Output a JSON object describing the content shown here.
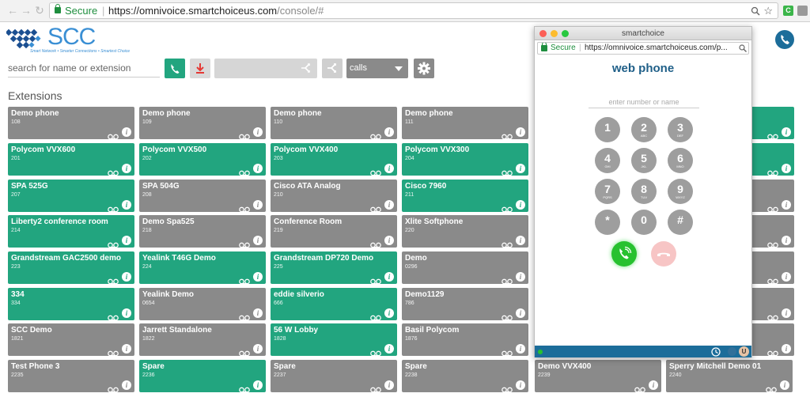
{
  "browser": {
    "secure_label": "Secure",
    "url_host": "https://omnivoice.smartchoiceus.com",
    "url_path": "/console/#",
    "ext_label": "C"
  },
  "brand": {
    "logo_text": "SCC",
    "tagline": "Smart Network • Smarter Connections • Smartest Choice",
    "accent": "#22a57f",
    "gray": "#8a8a8a",
    "blue": "#1c6d9a"
  },
  "toolbar": {
    "search_placeholder": "search for name or extension",
    "calls_label": "calls"
  },
  "section_title": "Extensions",
  "extensions": [
    [
      {
        "name": "Demo phone",
        "ext": "108",
        "status": "gray"
      },
      {
        "name": "Demo phone",
        "ext": "109",
        "status": "gray"
      },
      {
        "name": "Demo phone",
        "ext": "110",
        "status": "gray"
      },
      {
        "name": "Demo phone",
        "ext": "111",
        "status": "gray"
      }
    ],
    [
      {
        "name": "Polycom VVX600",
        "ext": "201",
        "status": "green"
      },
      {
        "name": "Polycom VVX500",
        "ext": "202",
        "status": "green"
      },
      {
        "name": "Polycom VVX400",
        "ext": "203",
        "status": "green"
      },
      {
        "name": "Polycom VVX300",
        "ext": "204",
        "status": "green"
      }
    ],
    [
      {
        "name": "SPA 525G",
        "ext": "207",
        "status": "green"
      },
      {
        "name": "SPA 504G",
        "ext": "208",
        "status": "gray"
      },
      {
        "name": "Cisco ATA Analog",
        "ext": "210",
        "status": "gray"
      },
      {
        "name": "Cisco 7960",
        "ext": "211",
        "status": "green"
      }
    ],
    [
      {
        "name": "Liberty2 conference room",
        "ext": "214",
        "status": "green"
      },
      {
        "name": "Demo Spa525",
        "ext": "218",
        "status": "gray"
      },
      {
        "name": "Conference Room",
        "ext": "219",
        "status": "gray"
      },
      {
        "name": "Xlite Softphone",
        "ext": "220",
        "status": "gray"
      }
    ],
    [
      {
        "name": "Grandstream GAC2500 demo",
        "ext": "223",
        "status": "green"
      },
      {
        "name": "Yealink T46G Demo",
        "ext": "224",
        "status": "green"
      },
      {
        "name": "Grandstream DP720 Demo",
        "ext": "225",
        "status": "green"
      },
      {
        "name": "Demo",
        "ext": "0296",
        "status": "gray"
      }
    ],
    [
      {
        "name": "334",
        "ext": "334",
        "status": "green"
      },
      {
        "name": "Yealink Demo",
        "ext": "0654",
        "status": "gray"
      },
      {
        "name": "eddie silverio",
        "ext": "666",
        "status": "green"
      },
      {
        "name": "Demo1129",
        "ext": "786",
        "status": "gray"
      }
    ],
    [
      {
        "name": "SCC Demo",
        "ext": "1821",
        "status": "gray"
      },
      {
        "name": "Jarrett Standalone",
        "ext": "1822",
        "status": "gray"
      },
      {
        "name": "56 W Lobby",
        "ext": "1828",
        "status": "green"
      },
      {
        "name": "Basil Polycom",
        "ext": "1876",
        "status": "gray"
      }
    ],
    [
      {
        "name": "Test Phone 3",
        "ext": "2235",
        "status": "gray"
      },
      {
        "name": "Spare",
        "ext": "2236",
        "status": "green"
      },
      {
        "name": "Spare",
        "ext": "2237",
        "status": "gray"
      },
      {
        "name": "Spare",
        "ext": "2238",
        "status": "gray"
      },
      {
        "name": "Demo VVX400",
        "ext": "2239",
        "status": "gray"
      },
      {
        "name": "Sperry Mitchell Demo 01",
        "ext": "2240",
        "status": "gray"
      }
    ]
  ],
  "right_column_status": [
    "green",
    "green",
    "gray",
    "gray",
    "gray",
    "gray",
    "gray"
  ],
  "popup": {
    "window_title": "smartchoice",
    "secure_label": "Secure",
    "url": "https://omnivoice.smartchoiceus.com/p...",
    "title": "web phone",
    "input_placeholder": "enter number or name",
    "keys": [
      {
        "digit": "1",
        "letters": ""
      },
      {
        "digit": "2",
        "letters": "ABC"
      },
      {
        "digit": "3",
        "letters": "DEF"
      },
      {
        "digit": "4",
        "letters": "GHI"
      },
      {
        "digit": "5",
        "letters": "JKL"
      },
      {
        "digit": "6",
        "letters": "MNO"
      },
      {
        "digit": "7",
        "letters": "PQRS"
      },
      {
        "digit": "8",
        "letters": "TUV"
      },
      {
        "digit": "9",
        "letters": "WXYZ"
      },
      {
        "digit": "*",
        "letters": ""
      },
      {
        "digit": "0",
        "letters": ""
      },
      {
        "digit": "#",
        "letters": ""
      }
    ],
    "user_badge": "U"
  }
}
